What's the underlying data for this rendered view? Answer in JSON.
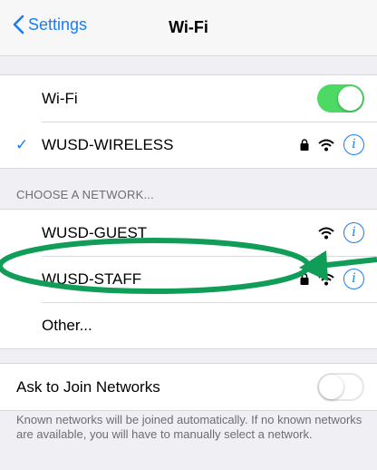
{
  "navbar": {
    "back_label": "Settings",
    "title": "Wi-Fi"
  },
  "wifi_section": {
    "wifi_label": "Wi-Fi",
    "wifi_on": true,
    "connected_network": "WUSD-WIRELESS"
  },
  "networks": {
    "header": "CHOOSE A NETWORK...",
    "items": [
      {
        "name": "WUSD-GUEST",
        "secured": false
      },
      {
        "name": "WUSD-STAFF",
        "secured": true
      }
    ],
    "other_label": "Other..."
  },
  "ask_join": {
    "label": "Ask to Join Networks",
    "on": false
  },
  "footer_text": "Known networks will be joined automatically. If no known networks are available, you will have to manually select a network.",
  "colors": {
    "accent": "#1a7cf5",
    "toggle_on": "#4cd964",
    "annotation": "#0f9d58"
  }
}
